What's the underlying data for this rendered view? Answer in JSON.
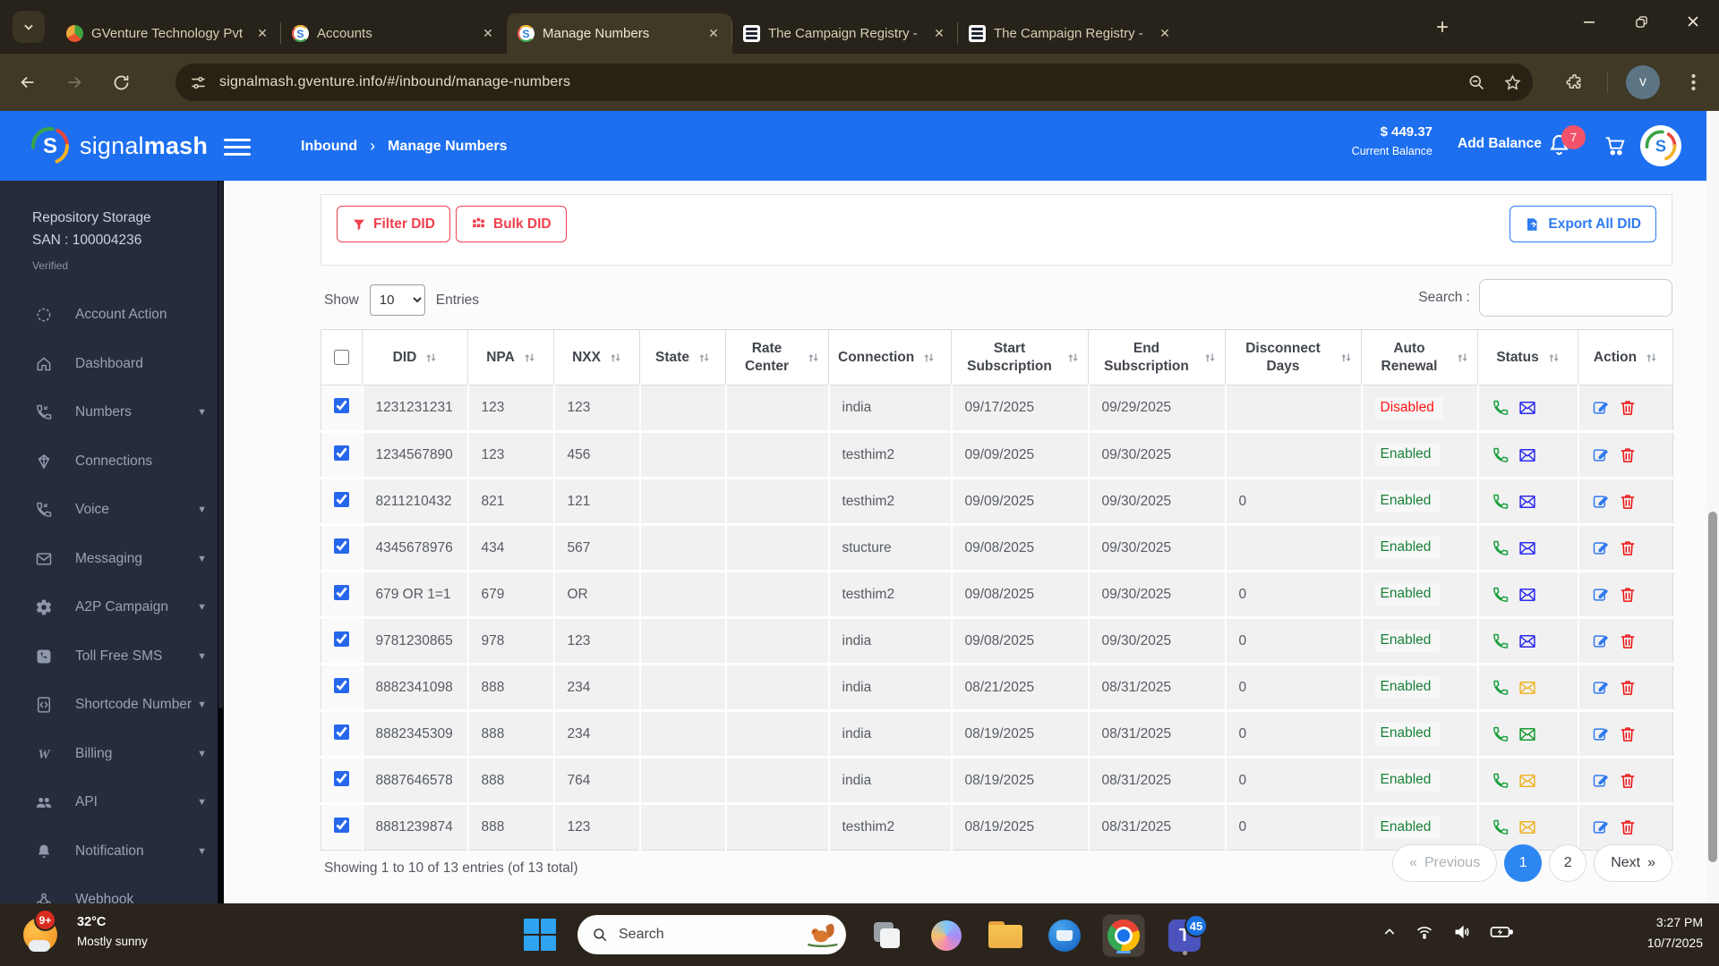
{
  "browser": {
    "tabs": [
      {
        "title": "GVenture Technology Pvt",
        "favicon": "gventure",
        "active": false
      },
      {
        "title": "Accounts",
        "favicon": "signalmash",
        "active": false
      },
      {
        "title": "Manage Numbers",
        "favicon": "signalmash",
        "active": true
      },
      {
        "title": "The Campaign Registry -",
        "favicon": "list",
        "active": false
      },
      {
        "title": "The Campaign Registry -",
        "favicon": "list",
        "active": false
      }
    ],
    "url": "signalmash.gventure.info/#/inbound/manage-numbers",
    "avatar_letter": "v"
  },
  "header": {
    "brand_light": "signal",
    "brand_bold": "mash",
    "breadcrumb_section": "Inbound",
    "breadcrumb_separator": "›",
    "breadcrumb_page": "Manage Numbers",
    "balance_amount": "$ 449.37",
    "balance_label": "Current Balance",
    "add_balance_label": "Add Balance",
    "notification_count": "7",
    "logo_letter": "S"
  },
  "sidebar": {
    "org_name": "Repository Storage",
    "org_id": "SAN : 100004236",
    "org_status": "Verified",
    "items": [
      {
        "label": "Account Action",
        "icon": "dots-circle-icon",
        "expandable": false
      },
      {
        "label": "Dashboard",
        "icon": "home-icon",
        "expandable": false
      },
      {
        "label": "Numbers",
        "icon": "phone-incoming-icon",
        "expandable": true
      },
      {
        "label": "Connections",
        "icon": "gem-icon",
        "expandable": false
      },
      {
        "label": "Voice",
        "icon": "phone-incoming-icon",
        "expandable": true
      },
      {
        "label": "Messaging",
        "icon": "envelope-icon",
        "expandable": true
      },
      {
        "label": "A2P Campaign",
        "icon": "gear-icon",
        "expandable": true
      },
      {
        "label": "Toll Free SMS",
        "icon": "phone-square-icon",
        "expandable": true
      },
      {
        "label": "Shortcode Number",
        "icon": "code-file-icon",
        "expandable": true
      },
      {
        "label": "Billing",
        "icon": "billing-icon",
        "expandable": true
      },
      {
        "label": "API",
        "icon": "users-icon",
        "expandable": true
      },
      {
        "label": "Notification",
        "icon": "bell-icon",
        "expandable": true
      },
      {
        "label": "Webhook",
        "icon": "webhook-icon",
        "expandable": false
      }
    ]
  },
  "actions_panel": {
    "filter_label": "Filter DID",
    "bulk_label": "Bulk DID",
    "export_label": "Export All DID"
  },
  "table_controls": {
    "show_label": "Show",
    "page_size": "10",
    "entries_label": "Entries",
    "search_label": "Search :",
    "search_value": ""
  },
  "table": {
    "columns": [
      "DID",
      "NPA",
      "NXX",
      "State",
      "Rate Center",
      "Connection",
      "Start Subscription",
      "End Subscription",
      "Disconnect Days",
      "Auto Renewal",
      "Status",
      "Action"
    ],
    "rows": [
      {
        "checked": true,
        "did": "1231231231",
        "npa": "123",
        "nxx": "123",
        "state": "",
        "rate_center": "",
        "connection": "india",
        "start": "09/17/2025",
        "end": "09/29/2025",
        "disconnect_days": "",
        "auto_renewal": "Disabled",
        "phone_color": "green",
        "envelope_color": "blue"
      },
      {
        "checked": true,
        "did": "1234567890",
        "npa": "123",
        "nxx": "456",
        "state": "",
        "rate_center": "",
        "connection": "testhim2",
        "start": "09/09/2025",
        "end": "09/30/2025",
        "disconnect_days": "",
        "auto_renewal": "Enabled",
        "phone_color": "green",
        "envelope_color": "blue"
      },
      {
        "checked": true,
        "did": "8211210432",
        "npa": "821",
        "nxx": "121",
        "state": "",
        "rate_center": "",
        "connection": "testhim2",
        "start": "09/09/2025",
        "end": "09/30/2025",
        "disconnect_days": "0",
        "auto_renewal": "Enabled",
        "phone_color": "green",
        "envelope_color": "blue"
      },
      {
        "checked": true,
        "did": "4345678976",
        "npa": "434",
        "nxx": "567",
        "state": "",
        "rate_center": "",
        "connection": "stucture",
        "start": "09/08/2025",
        "end": "09/30/2025",
        "disconnect_days": "",
        "auto_renewal": "Enabled",
        "phone_color": "green",
        "envelope_color": "blue"
      },
      {
        "checked": true,
        "did": "679 OR 1=1",
        "npa": "679",
        "nxx": "OR",
        "state": "",
        "rate_center": "",
        "connection": "testhim2",
        "start": "09/08/2025",
        "end": "09/30/2025",
        "disconnect_days": "0",
        "auto_renewal": "Enabled",
        "phone_color": "green",
        "envelope_color": "blue"
      },
      {
        "checked": true,
        "did": "9781230865",
        "npa": "978",
        "nxx": "123",
        "state": "",
        "rate_center": "",
        "connection": "india",
        "start": "09/08/2025",
        "end": "09/30/2025",
        "disconnect_days": "0",
        "auto_renewal": "Enabled",
        "phone_color": "green",
        "envelope_color": "blue"
      },
      {
        "checked": true,
        "did": "8882341098",
        "npa": "888",
        "nxx": "234",
        "state": "",
        "rate_center": "",
        "connection": "india",
        "start": "08/21/2025",
        "end": "08/31/2025",
        "disconnect_days": "0",
        "auto_renewal": "Enabled",
        "phone_color": "green",
        "envelope_color": "yellow"
      },
      {
        "checked": true,
        "did": "8882345309",
        "npa": "888",
        "nxx": "234",
        "state": "",
        "rate_center": "",
        "connection": "india",
        "start": "08/19/2025",
        "end": "08/31/2025",
        "disconnect_days": "0",
        "auto_renewal": "Enabled",
        "phone_color": "green",
        "envelope_color": "green"
      },
      {
        "checked": true,
        "did": "8887646578",
        "npa": "888",
        "nxx": "764",
        "state": "",
        "rate_center": "",
        "connection": "india",
        "start": "08/19/2025",
        "end": "08/31/2025",
        "disconnect_days": "0",
        "auto_renewal": "Enabled",
        "phone_color": "green",
        "envelope_color": "yellow"
      },
      {
        "checked": true,
        "did": "8881239874",
        "npa": "888",
        "nxx": "123",
        "state": "",
        "rate_center": "",
        "connection": "testhim2",
        "start": "08/19/2025",
        "end": "08/31/2025",
        "disconnect_days": "0",
        "auto_renewal": "Enabled",
        "phone_color": "green",
        "envelope_color": "yellow"
      }
    ]
  },
  "table_footer": {
    "summary": "Showing 1 to 10 of 13 entries (of 13 total)",
    "prev_label": "Previous",
    "prev_arrow": "«",
    "pages": [
      "1",
      "2"
    ],
    "active_page": "1",
    "next_label": "Next",
    "next_arrow": "»"
  },
  "taskbar": {
    "weather_badge": "9+",
    "weather_temp": "32°C",
    "weather_desc": "Mostly sunny",
    "search_placeholder": "Search",
    "apps": [
      {
        "name": "task-view",
        "active": false
      },
      {
        "name": "copilot",
        "active": false
      },
      {
        "name": "file-explorer",
        "active": false
      },
      {
        "name": "thunderbird",
        "active": false
      },
      {
        "name": "chrome",
        "active": true
      },
      {
        "name": "teams",
        "active": false,
        "badge": "45",
        "running": true
      }
    ],
    "teams_badge": "45",
    "time": "3:27 PM",
    "date": "10/7/2025"
  },
  "colors": {
    "header_blue": "#1d6ff0",
    "sidebar_bg": "#262c3c",
    "danger_red": "#f0414d",
    "export_blue": "#2f7bf0",
    "enabled_green": "#188038",
    "disabled_red": "#ff1212",
    "phone_green": "#18a03c",
    "envelope_blue": "#2a2af0",
    "envelope_yellow": "#f0b428",
    "envelope_green": "#169a2f",
    "edit_blue": "#3179ef",
    "trash_red": "#ee1111",
    "notification_badge": "#f2536a",
    "pagination_active": "#2e86f0",
    "checkbox_blue": "#2767ec"
  }
}
